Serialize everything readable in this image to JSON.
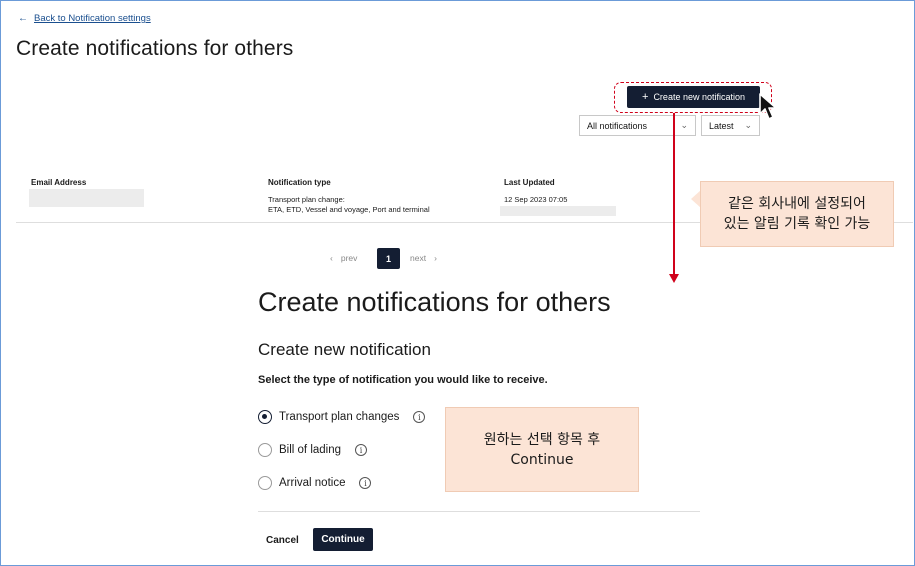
{
  "colors": {
    "primary_button": "#141e33",
    "link": "#1a4f8f",
    "annotation_red": "#d0021b",
    "callout_bg": "#fce4d6"
  },
  "header": {
    "back_link": "Back to Notification settings",
    "back_icon": "arrow-left-icon",
    "title": "Create notifications for others"
  },
  "toolbar": {
    "create_button": "Create new notification",
    "create_icon": "plus-icon",
    "filter_select": {
      "value": "All notifications"
    },
    "sort_select": {
      "value": "Latest"
    }
  },
  "table": {
    "columns": [
      "Email Address",
      "Notification type",
      "Last Updated"
    ],
    "rows": [
      {
        "notification_type_line1": "Transport plan change:",
        "notification_type_line2": "ETA, ETD, Vessel and voyage, Port and terminal",
        "last_updated": "12 Sep 2023 07:05"
      }
    ]
  },
  "pagination": {
    "prev": "prev",
    "current": "1",
    "next": "next"
  },
  "annotations": {
    "callout_history_line1": "같은 회사내에 설정되어",
    "callout_history_line2": "있는 알림 기록 확인 가능",
    "callout_select_line1": "원하는 선택 항목 후",
    "callout_select_line2": "Continue"
  },
  "form": {
    "title": "Create notifications for others",
    "subtitle": "Create new notification",
    "instruction": "Select the type of notification you would like to receive.",
    "options": [
      {
        "label": "Transport plan changes",
        "selected": true
      },
      {
        "label": "Bill of lading",
        "selected": false
      },
      {
        "label": "Arrival notice",
        "selected": false
      }
    ],
    "info_icon_glyph": "i",
    "cancel": "Cancel",
    "continue": "Continue"
  }
}
